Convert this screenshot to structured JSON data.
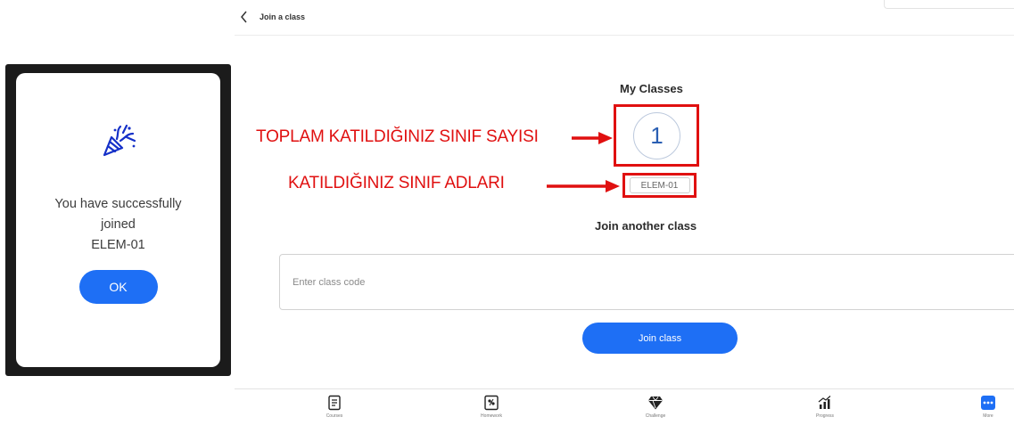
{
  "modal": {
    "icon": "party-popper-icon",
    "message_line1": "You have successfully",
    "message_line2": "joined",
    "class_name": "ELEM-01",
    "ok_label": "OK"
  },
  "topbar": {
    "back_icon": "chevron-left-icon",
    "title": "Join a class"
  },
  "my_classes": {
    "title": "My Classes",
    "count": "1",
    "classes": [
      "ELEM-01"
    ]
  },
  "annotations": {
    "total_classes": "TOPLAM KATILDIĞINIZ SINIF SAYISI",
    "class_names": "KATILDIĞINIZ SINIF ADLARI",
    "color": "#e01010"
  },
  "join_another": {
    "title": "Join another class",
    "input_placeholder": "Enter class code",
    "input_value": "",
    "button_label": "Join class"
  },
  "bottom_nav": {
    "items": [
      {
        "label": "Courses",
        "icon": "book-icon"
      },
      {
        "label": "Homework",
        "icon": "homework-icon"
      },
      {
        "label": "Challenge",
        "icon": "diamond-icon"
      },
      {
        "label": "Progress",
        "icon": "chart-icon"
      },
      {
        "label": "More",
        "icon": "more-icon"
      }
    ]
  },
  "colors": {
    "accent": "#1e6ff5",
    "annotation_red": "#e01010",
    "count_text": "#2a5fb3"
  }
}
